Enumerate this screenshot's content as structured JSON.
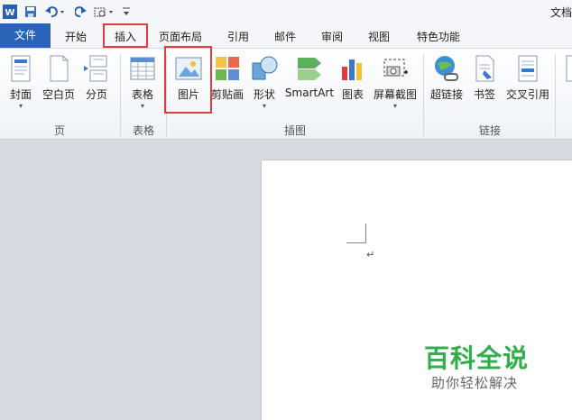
{
  "window": {
    "title": "文档"
  },
  "tabs": {
    "file": "文件",
    "home": "开始",
    "insert": "插入",
    "layout": "页面布局",
    "references": "引用",
    "mailings": "邮件",
    "review": "审阅",
    "view": "视图",
    "special": "特色功能"
  },
  "ribbon": {
    "pages": {
      "cover": "封面",
      "blank": "空白页",
      "break": "分页",
      "group": "页"
    },
    "tables": {
      "table": "表格",
      "group": "表格"
    },
    "illustrations": {
      "picture": "图片",
      "clipart": "剪贴画",
      "shapes": "形状",
      "smartart": "SmartArt",
      "chart": "图表",
      "screenshot": "屏幕截图",
      "group": "插图"
    },
    "links": {
      "hyperlink": "超链接",
      "bookmark": "书签",
      "crossref": "交叉引用",
      "group": "链接"
    }
  },
  "document": {
    "paragraph_mark": "↵"
  },
  "watermark": {
    "title": "百科全说",
    "subtitle": "助你轻松解决"
  },
  "colors": {
    "file_tab": "#2a64b8",
    "highlight": "#e23b3b",
    "watermark": "#2fae4b"
  }
}
